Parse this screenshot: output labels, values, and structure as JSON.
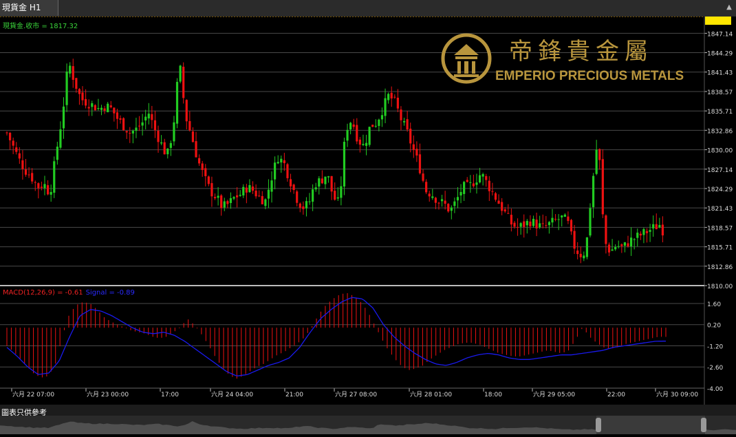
{
  "tab": {
    "title": "現貨金 H1",
    "button_icon": "scroll-up-icon"
  },
  "price_panel": {
    "label": "現貨金.收市 = 1817.32",
    "current_price": 1817.32,
    "current_label": "1817.32"
  },
  "macd_panel": {
    "label": "MACD(12,26,9) = -0.61",
    "signal_label": "Signal = -0.89"
  },
  "brand": {
    "name": "EMPERIO PRECIOUS METALS",
    "chinese": "帝鋒貴金屬"
  },
  "footer": {
    "label": "圖表只供參考"
  },
  "colors": {
    "bull": "#22cc22",
    "bear": "#ee1111",
    "signal": "#1a1aee",
    "grid": "#4a4a4a",
    "gold": "#b8953d",
    "price_line": "#e6a100"
  },
  "chart_data": [
    {
      "type": "candlestick",
      "title": "現貨金 H1",
      "ylim": [
        1810.0,
        1849.0
      ],
      "y_ticks": [
        "1847.14",
        "1844.29",
        "1841.43",
        "1838.57",
        "1835.71",
        "1832.86",
        "1830.00",
        "1827.14",
        "1824.29",
        "1821.43",
        "1818.57",
        "1815.71",
        "1812.86",
        "1810.00"
      ],
      "x_ticks": [
        "六月 22 07:00",
        "六月 23 00:00",
        "17:00",
        "六月 24 04:00",
        "21:00",
        "六月 27 08:00",
        "六月 28 01:00",
        "18:00",
        "六月 29 05:00",
        "22:00",
        "六月 30 09:00"
      ],
      "close_path": [
        1832.5,
        1830.5,
        1828.5,
        1827.0,
        1826.0,
        1824.5,
        1825.0,
        1823.5,
        1829.5,
        1835.0,
        1843.0,
        1840.0,
        1837.5,
        1837.0,
        1836.5,
        1836.0,
        1836.5,
        1836.0,
        1834.5,
        1833.5,
        1832.5,
        1833.0,
        1834.0,
        1835.5,
        1833.0,
        1831.0,
        1829.0,
        1833.0,
        1843.0,
        1835.0,
        1832.0,
        1828.5,
        1826.0,
        1824.0,
        1823.0,
        1821.5,
        1822.0,
        1823.0,
        1823.5,
        1824.5,
        1824.0,
        1823.0,
        1822.5,
        1826.0,
        1829.0,
        1828.0,
        1825.5,
        1823.0,
        1821.5,
        1822.0,
        1825.0,
        1825.5,
        1826.5,
        1823.0,
        1822.0,
        1833.0,
        1834.5,
        1831.5,
        1830.5,
        1833.5,
        1834.0,
        1836.0,
        1838.0,
        1837.0,
        1834.5,
        1832.5,
        1830.0,
        1827.5,
        1824.0,
        1823.5,
        1822.5,
        1822.0,
        1821.0,
        1822.5,
        1824.5,
        1824.5,
        1825.5,
        1826.5,
        1825.0,
        1823.5,
        1822.0,
        1820.5,
        1819.0,
        1818.5,
        1819.0,
        1819.5,
        1819.0,
        1818.5,
        1819.0,
        1819.5,
        1820.0,
        1819.5,
        1816.0,
        1814.5,
        1815.0,
        1824.5,
        1832.0,
        1816.5,
        1815.0,
        1816.0,
        1815.5,
        1816.5,
        1817.0,
        1817.5,
        1818.0,
        1818.5,
        1819.0,
        1817.32
      ]
    },
    {
      "type": "macd",
      "title": "MACD(12,26,9)",
      "ylim": [
        -4.0,
        2.6
      ],
      "y_ticks": [
        "1.60",
        "0.20",
        "-1.20",
        "-2.60",
        "-4.00"
      ],
      "macd_last": -0.61,
      "signal_last": -0.89,
      "histogram_path": [
        -1.2,
        -1.6,
        -2.1,
        -2.6,
        -3.1,
        -3.3,
        -3.2,
        -2.4,
        -0.6,
        0.9,
        1.5,
        1.7,
        1.6,
        1.2,
        0.7,
        0.4,
        0.2,
        0.0,
        -0.2,
        -0.3,
        -0.4,
        -0.6,
        -0.7,
        -0.6,
        -0.3,
        0.0,
        0.6,
        0.2,
        -0.4,
        -1.1,
        -1.9,
        -2.6,
        -3.1,
        -3.4,
        -3.2,
        -2.9,
        -2.6,
        -2.4,
        -2.1,
        -1.8,
        -1.6,
        -1.3,
        -1.0,
        -0.6,
        0.1,
        0.9,
        1.5,
        1.9,
        2.2,
        2.3,
        2.1,
        1.7,
        1.1,
        0.2,
        -0.7,
        -1.5,
        -2.1,
        -2.6,
        -2.8,
        -2.7,
        -2.5,
        -2.1,
        -1.8,
        -1.5,
        -1.3,
        -1.1,
        -1.0,
        -1.0,
        -1.1,
        -1.3,
        -1.5,
        -1.7,
        -1.8,
        -1.9,
        -1.9,
        -1.8,
        -1.7,
        -1.6,
        -1.5,
        -1.6,
        -1.7,
        -1.5,
        -0.8,
        0.0,
        -0.6,
        -1.0,
        -1.3,
        -1.4,
        -1.3,
        -1.1,
        -1.0,
        -0.9,
        -0.8,
        -0.7,
        -0.6,
        -0.61
      ],
      "signal_path": [
        -1.3,
        -1.9,
        -2.6,
        -3.1,
        -3.0,
        -2.2,
        -0.6,
        0.8,
        1.2,
        1.1,
        0.8,
        0.4,
        0.0,
        -0.3,
        -0.4,
        -0.3,
        -0.5,
        -0.9,
        -1.4,
        -1.9,
        -2.4,
        -2.9,
        -3.2,
        -3.1,
        -2.8,
        -2.5,
        -2.3,
        -2.0,
        -1.3,
        -0.3,
        0.6,
        1.2,
        1.7,
        2.0,
        1.9,
        1.3,
        0.2,
        -0.6,
        -1.2,
        -1.7,
        -2.1,
        -2.4,
        -2.5,
        -2.3,
        -2.0,
        -1.8,
        -1.7,
        -1.8,
        -2.0,
        -2.1,
        -2.1,
        -2.0,
        -1.9,
        -1.8,
        -1.8,
        -1.7,
        -1.6,
        -1.5,
        -1.3,
        -1.2,
        -1.1,
        -1.0,
        -0.9,
        -0.89
      ]
    }
  ]
}
